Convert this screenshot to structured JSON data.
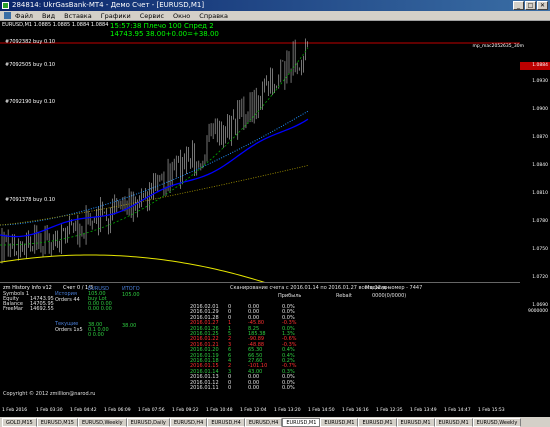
{
  "title": "284814: UkrGasBank-MT4 - Демо Счет - [EURUSD,M1]",
  "window_buttons": [
    "_",
    "□",
    "✕"
  ],
  "menu": [
    "Файл",
    "Вид",
    "Вставка",
    "Графики",
    "Сервис",
    "Окно",
    "Справка"
  ],
  "chart": {
    "header": "EURUSD,M1  1.0885 1.0885 1.0884 1.0884",
    "expert": "mp_mac2052635_30m",
    "info_line1": "15:57:38 Плечо 100 Спред 2",
    "info_line2": "14743.95 38.00+0.00=+38.00",
    "orders": [
      "#7092382 buy 0.10",
      "#7092505 buy 0.10",
      "#7092190 buy 0.10",
      "#7091378 buy 0.10"
    ],
    "price_box": "1.0884",
    "price_labels": [
      "1.0930",
      "1.0900",
      "1.0870",
      "1.0840",
      "1.0810",
      "1.0780",
      "1.0750",
      "1.0720",
      "1.0690"
    ],
    "panel_axis_label": "9000000",
    "time_labels": [
      "1 Feb 2016",
      "1 Feb 03:30",
      "1 Feb 04:42",
      "1 Feb 06:09",
      "1 Feb 07:56",
      "1 Feb 09:22",
      "1 Feb 10:48",
      "1 Feb 12:04",
      "1 Feb 13:20",
      "1 Feb 14:50",
      "1 Feb 16:16",
      "1 Feb 12:35",
      "1 Feb 13:49",
      "1 Feb 14:47",
      "1 Feb 15:53"
    ]
  },
  "panel": {
    "title": "zm History Info v12",
    "account_count": "Счет 0 / 1/3",
    "labels": [
      "Symbols 1",
      "Equity",
      "Balance",
      "FreeMar"
    ],
    "values": [
      "14743.95",
      "14705.95",
      "14692.55"
    ],
    "history_label": "История",
    "orders_44": "Orders 44",
    "current_label": "Текущие",
    "orders_1x5": "Orders 1x5",
    "eurusd": "EURUSD",
    "itogo": "ИТОГО",
    "eur_vals": [
      "105.00",
      "buy  Lot",
      "0.00  0.00",
      "0.00  0.00"
    ],
    "itogo_vals": [
      "105.00"
    ],
    "cur_val": "38.00",
    "cur_itogo": "38.00",
    "cur_small": [
      "0.1  0.00",
      "0  0.00"
    ],
    "scan_text": "Сканирование счета с 2016.01.14 по 2016.01.27 всего 12 дн.",
    "magic": "Маджик номер - 7447",
    "profit_label": "Прибыль",
    "rebate_label": "Rebait",
    "rebate_val": "0000(0/0000)",
    "copyright": "Copyright © 2012 zmillion@narod.ru",
    "history": [
      {
        "d": "2016.02.01",
        "n": "0",
        "p": "0.00",
        "pc": "0.0%",
        "c": "white"
      },
      {
        "d": "2016.01.29",
        "n": "0",
        "p": "0.00",
        "pc": "0.0%",
        "c": "white"
      },
      {
        "d": "2016.01.28",
        "n": "0",
        "p": "0.00",
        "pc": "0.0%",
        "c": "white"
      },
      {
        "d": "2016.01.27",
        "n": "1",
        "p": "-45.80",
        "pc": "-0.3%",
        "c": "red"
      },
      {
        "d": "2016.01.26",
        "n": "1",
        "p": "8.25",
        "pc": "0.0%",
        "c": "green"
      },
      {
        "d": "2016.01.25",
        "n": "5",
        "p": "185.38",
        "pc": "1.3%",
        "c": "green"
      },
      {
        "d": "2016.01.22",
        "n": "2",
        "p": "-90.89",
        "pc": "-0.6%",
        "c": "red"
      },
      {
        "d": "2016.01.21",
        "n": "3",
        "p": "-48.88",
        "pc": "-0.3%",
        "c": "red"
      },
      {
        "d": "2016.01.20",
        "n": "6",
        "p": "65.30",
        "pc": "0.4%",
        "c": "green"
      },
      {
        "d": "2016.01.19",
        "n": "6",
        "p": "66.50",
        "pc": "0.4%",
        "c": "green"
      },
      {
        "d": "2016.01.18",
        "n": "4",
        "p": "27.60",
        "pc": "0.2%",
        "c": "green"
      },
      {
        "d": "2016.01.15",
        "n": "2",
        "p": "-101.10",
        "pc": "-0.7%",
        "c": "red"
      },
      {
        "d": "2016.01.14",
        "n": "3",
        "p": "43.00",
        "pc": "0.3%",
        "c": "green"
      },
      {
        "d": "2016.01.13",
        "n": "0",
        "p": "0.00",
        "pc": "0.0%",
        "c": "white"
      },
      {
        "d": "2016.01.12",
        "n": "0",
        "p": "0.00",
        "pc": "0.0%",
        "c": "white"
      },
      {
        "d": "2016.01.11",
        "n": "0",
        "p": "0.00",
        "pc": "0.0%",
        "c": "white"
      }
    ]
  },
  "tabs": [
    "GOLD,M15",
    "EURUSD,M15",
    "EURUSD,Weekly",
    "EURUSD,Daily",
    "EURUSD,H4",
    "EURUSD,H4",
    "EURUSD,H4",
    "EURUSD,M1",
    "EURUSD,M1",
    "EURUSD,M1",
    "EURUSD,M1",
    "EURUSD,M1",
    "EURUSD,Weekly"
  ],
  "active_tab": 7,
  "colors": {
    "background": "#000000",
    "candles": "#c0c0c0",
    "ma_blue": "#0000ff",
    "ma_yellow": "#e6e600",
    "envelope": "#00aa00",
    "price_line": "#ff0000"
  }
}
